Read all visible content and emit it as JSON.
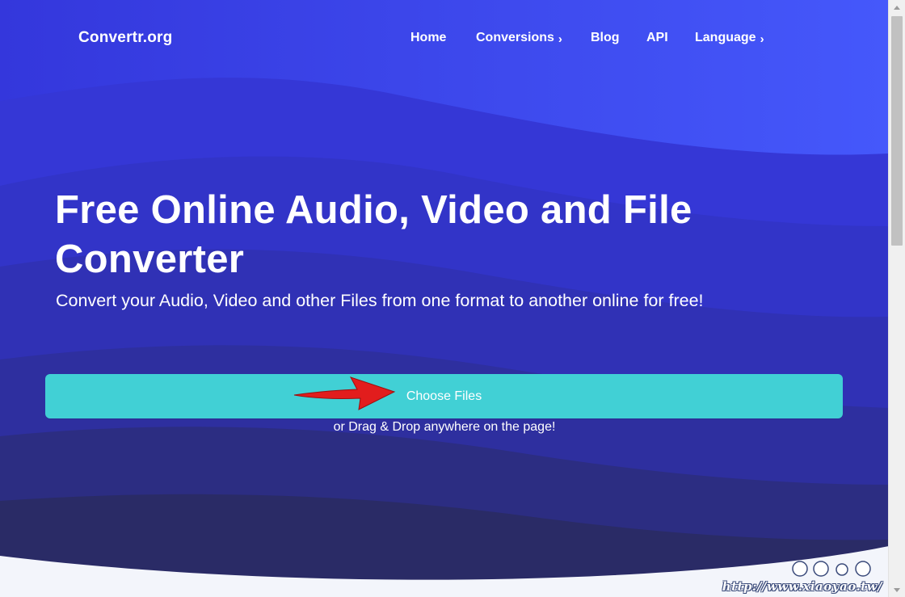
{
  "header": {
    "logo": "Convertr.org",
    "nav": [
      {
        "label": "Home",
        "chevron": ""
      },
      {
        "label": "Conversions",
        "chevron": "›"
      },
      {
        "label": "Blog",
        "chevron": ""
      },
      {
        "label": "API",
        "chevron": ""
      },
      {
        "label": "Language",
        "chevron": "›"
      }
    ]
  },
  "hero": {
    "title": "Free Online Audio, Video and File Converter",
    "subtitle": "Convert your Audio, Video and other Files from one format to another online for free!"
  },
  "upload": {
    "button_label": "Choose Files",
    "hint": "or Drag & Drop anywhere on the page!"
  },
  "watermark": {
    "url": "http://www.xiaoyao.tw/"
  },
  "icons": {
    "annotation": "red-arrow-icon",
    "watermark_logo": "xiaoyao-logo-icon",
    "scroll_up": "chevron-up-icon",
    "scroll_down": "chevron-down-icon"
  },
  "colors": {
    "background_top": "#3a3ee3",
    "background_bottom": "#272a55",
    "button": "#41d0d5",
    "arrow": "#e21d1d"
  }
}
